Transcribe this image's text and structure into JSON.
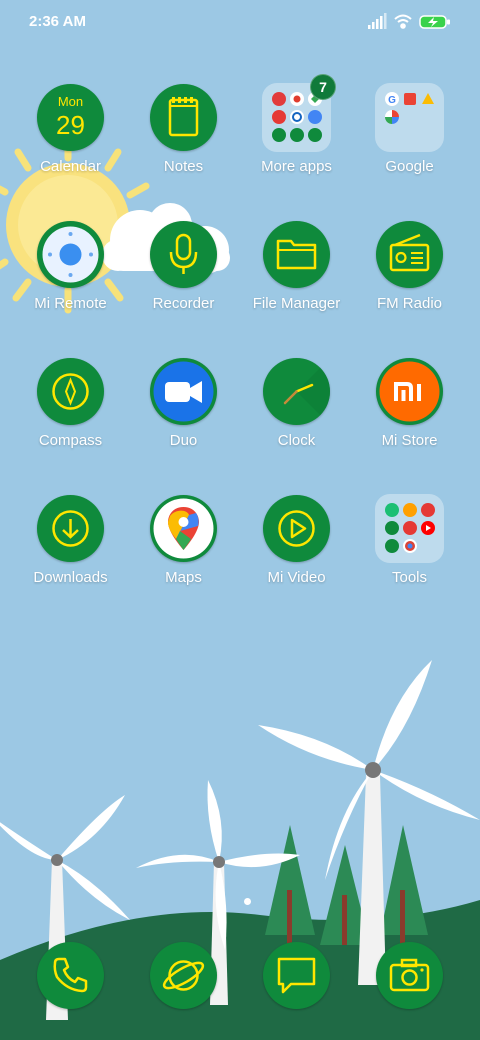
{
  "status_bar": {
    "time": "2:36 AM"
  },
  "apps": {
    "calendar": {
      "label": "Calendar",
      "day": "Mon",
      "date": "29"
    },
    "notes": {
      "label": "Notes"
    },
    "more_apps": {
      "label": "More apps",
      "badge": "7"
    },
    "google": {
      "label": "Google"
    },
    "mi_remote": {
      "label": "Mi Remote"
    },
    "recorder": {
      "label": "Recorder"
    },
    "file_manager": {
      "label": "File Manager"
    },
    "fm_radio": {
      "label": "FM Radio"
    },
    "compass": {
      "label": "Compass"
    },
    "duo": {
      "label": "Duo"
    },
    "clock": {
      "label": "Clock"
    },
    "mi_store": {
      "label": "Mi Store",
      "logo": "mi"
    },
    "downloads": {
      "label": "Downloads"
    },
    "maps": {
      "label": "Maps"
    },
    "mi_video": {
      "label": "Mi Video"
    },
    "tools": {
      "label": "Tools"
    }
  },
  "dock": [
    "phone-icon",
    "browser-icon",
    "messages-icon",
    "camera-icon"
  ],
  "colors": {
    "icon_green": "#0f8a3c",
    "icon_yellow": "#ffe600",
    "sky": "#9cc8e4"
  }
}
